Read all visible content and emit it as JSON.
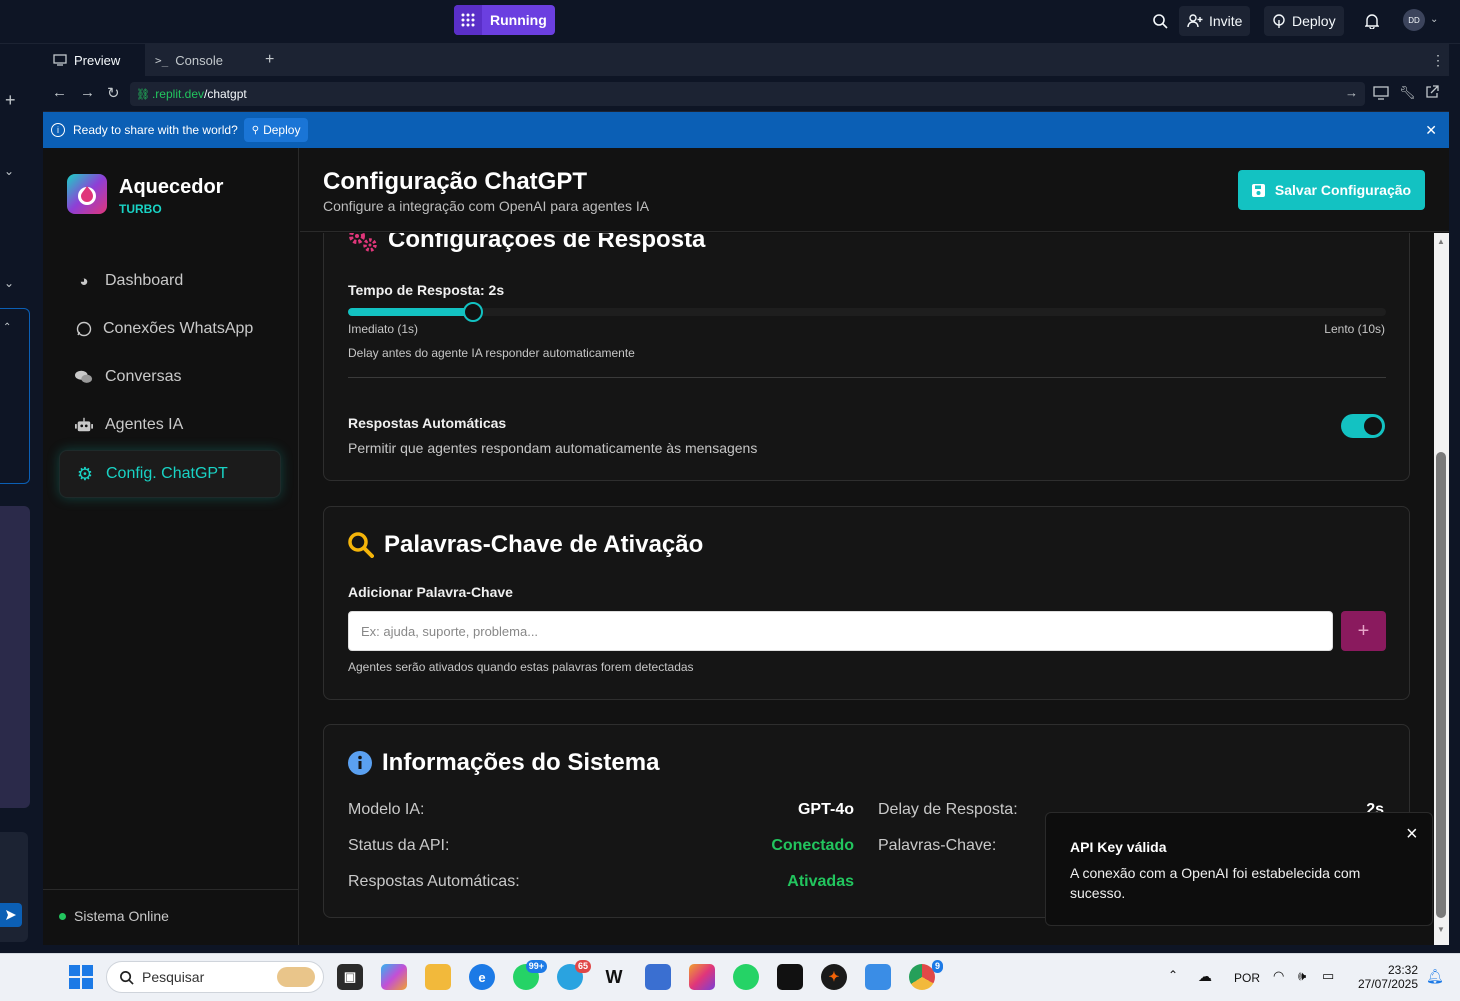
{
  "topbar": {
    "running_label": "Running",
    "invite_label": "Invite",
    "deploy_label": "Deploy",
    "avatar_initials": "DD"
  },
  "tabs": [
    {
      "label": "Preview"
    },
    {
      "label": "Console"
    }
  ],
  "url": {
    "domain": ".replit.dev",
    "path": "/chatgpt"
  },
  "banner": {
    "text": "Ready to share with the world?",
    "deploy_label": "Deploy"
  },
  "sidebar": {
    "brand": "Aquecedor",
    "brand_sub": "TURBO",
    "items": [
      {
        "label": "Dashboard",
        "icon": "palette-icon"
      },
      {
        "label": "Conexões WhatsApp",
        "icon": "whatsapp-icon"
      },
      {
        "label": "Conversas",
        "icon": "comments-icon"
      },
      {
        "label": "Agentes IA",
        "icon": "robot-icon"
      },
      {
        "label": "Config. ChatGPT",
        "icon": "gear-icon",
        "active": true
      }
    ],
    "status": "Sistema Online"
  },
  "header": {
    "title": "Configuração ChatGPT",
    "subtitle": "Configure a integração com OpenAI para agentes IA",
    "save_label": "Salvar Configuração"
  },
  "response_card": {
    "title": "Configurações de Resposta",
    "slider_label": "Tempo de Resposta: 2s",
    "slider_value": 2,
    "slider_min": 1,
    "slider_max": 10,
    "min_label": "Imediato (1s)",
    "max_label": "Lento (10s)",
    "slider_help": "Delay antes do agente IA responder automaticamente",
    "auto_label": "Respostas Automáticas",
    "auto_desc": "Permitir que agentes respondam automaticamente às mensagens",
    "auto_on": true
  },
  "keywords_card": {
    "title": "Palavras-Chave de Ativação",
    "label": "Adicionar Palavra-Chave",
    "placeholder": "Ex: ajuda, suporte, problema...",
    "help": "Agentes serão ativados quando estas palavras forem detectadas",
    "add_label": "+"
  },
  "info_card": {
    "title": "Informações do Sistema",
    "left": [
      {
        "label": "Modelo IA:",
        "value": "GPT-4o",
        "color": "#ffffff"
      },
      {
        "label": "Status da API:",
        "value": "Conectado",
        "color": "#22c55e"
      },
      {
        "label": "Respostas Automáticas:",
        "value": "Ativadas",
        "color": "#22c55e"
      }
    ],
    "right": [
      {
        "label": "Delay de Resposta:",
        "value": "2s"
      },
      {
        "label": "Palavras-Chave:",
        "value": ""
      }
    ]
  },
  "toast": {
    "title": "API Key válida",
    "message": "A conexão com a OpenAI foi estabelecida com sucesso.",
    "close": "×"
  },
  "taskbar": {
    "search_placeholder": "Pesquisar",
    "whatsapp_badge": "99+",
    "telegram_badge": "65",
    "chrome_badge": "9",
    "lang": "POR",
    "time": "23:32",
    "date": "27/07/2025"
  },
  "colors": {
    "accent": "#13c2c2",
    "success": "#22c55e",
    "magenta": "#e0367a"
  }
}
